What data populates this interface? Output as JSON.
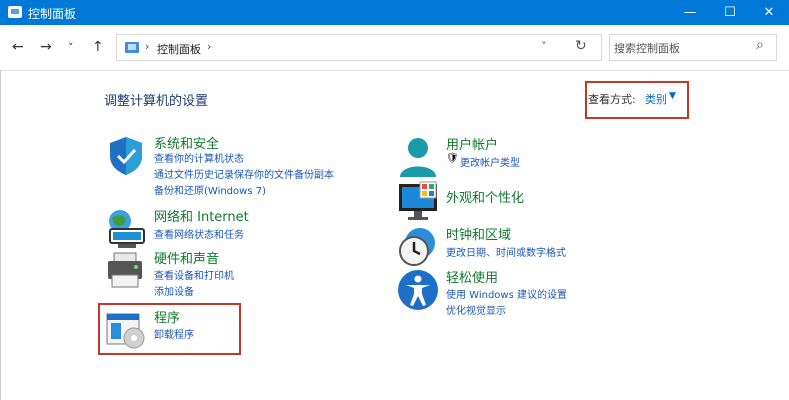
{
  "window": {
    "title": "控制面板",
    "minimize": "—",
    "maximize": "☐",
    "close": "✕"
  },
  "nav": {
    "back": "←",
    "forward": "→",
    "recent": "˅",
    "up": "↑"
  },
  "address": {
    "chevron": "›",
    "crumb": "控制面板",
    "crumb_sep": "›",
    "dropdown": "˅",
    "refresh": "↻"
  },
  "search": {
    "placeholder": "搜索控制面板",
    "icon": "search-icon"
  },
  "page_title": "调整计算机的设置",
  "view_by": {
    "label": "查看方式:",
    "value": "类别"
  },
  "categories_left": [
    {
      "title": "系统和安全",
      "icon": "shield-icon",
      "links": [
        "查看你的计算机状态",
        "通过文件历史记录保存你的文件备份副本",
        "备份和还原(Windows 7)"
      ]
    },
    {
      "title": "网络和 Internet",
      "icon": "network-icon",
      "links": [
        "查看网络状态和任务"
      ]
    },
    {
      "title": "硬件和声音",
      "icon": "printer-icon",
      "links": [
        "查看设备和打印机",
        "添加设备"
      ]
    },
    {
      "title": "程序",
      "icon": "programs-icon",
      "links": [
        "卸载程序"
      ]
    }
  ],
  "categories_right": [
    {
      "title": "用户帐户",
      "icon": "user-icon",
      "links": [
        "更改帐户类型"
      ]
    },
    {
      "title": "外观和个性化",
      "icon": "monitor-icon",
      "links": []
    },
    {
      "title": "时钟和区域",
      "icon": "clock-icon",
      "links": [
        "更改日期、时间或数字格式"
      ]
    },
    {
      "title": "轻松使用",
      "icon": "accessibility-icon",
      "links": [
        "使用 Windows 建议的设置",
        "优化视觉显示"
      ]
    }
  ],
  "colors": {
    "titlebar": "#0078d7",
    "category_heading": "#0e7a2c",
    "link": "#1a57b8",
    "highlight_box": "#c0392b"
  }
}
